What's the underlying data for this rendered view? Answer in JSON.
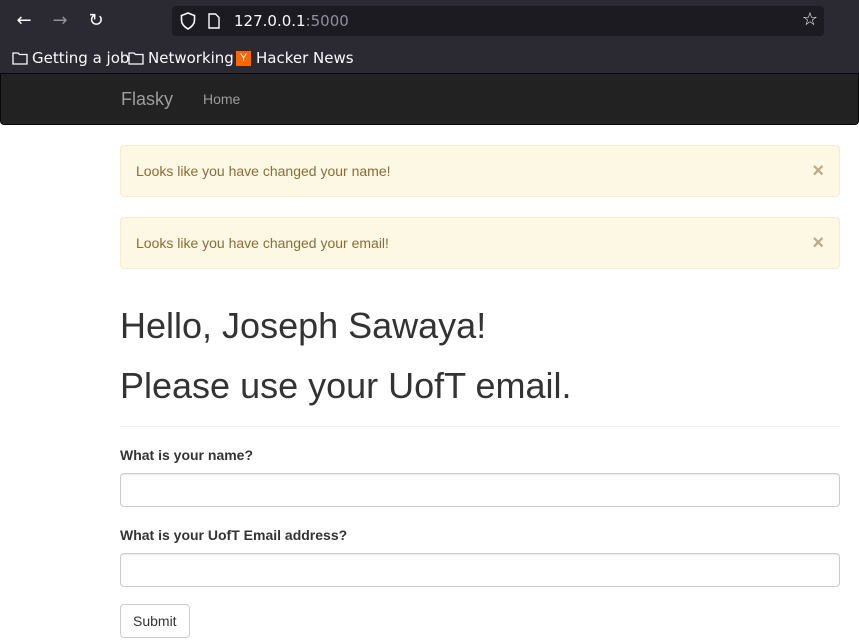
{
  "browser": {
    "url_host": "127.0.0.1",
    "url_port": ":5000",
    "bookmarks": [
      {
        "label": "Getting a job",
        "icon": "folder-icon"
      },
      {
        "label": "Networking",
        "icon": "folder-icon"
      },
      {
        "label": "Hacker News",
        "icon": "hacker-news-icon",
        "icon_text": "Y"
      }
    ]
  },
  "navbar": {
    "brand": "Flasky",
    "home": "Home"
  },
  "alerts": [
    {
      "message": "Looks like you have changed your name!",
      "close": "×"
    },
    {
      "message": "Looks like you have changed your email!",
      "close": "×"
    }
  ],
  "header": {
    "greeting": "Hello, Joseph Sawaya!",
    "subheading": "Please use your UofT email."
  },
  "form": {
    "name_label": "What is your name?",
    "name_value": "",
    "email_label": "What is your UofT Email address?",
    "email_value": "",
    "submit_label": "Submit"
  }
}
